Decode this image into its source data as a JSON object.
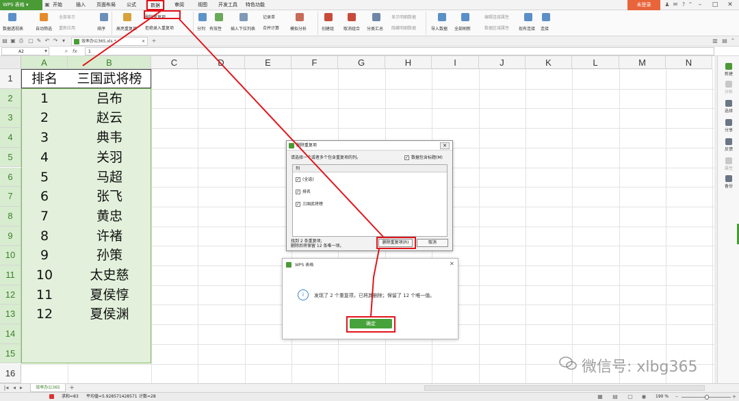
{
  "app": {
    "name": "WPS 表格",
    "login_label": "未登录"
  },
  "menu": {
    "tabs": [
      "开始",
      "插入",
      "页面布局",
      "公式",
      "数据",
      "审阅",
      "视图",
      "开发工具",
      "特色功能"
    ],
    "active_tab": "数据"
  },
  "ribbon": {
    "items": [
      "数据透视表",
      "自动筛选",
      "全部显示",
      "重新应用",
      "排序",
      "高亮重复项",
      "删除重复项",
      "拒绝录入重复项",
      "分列",
      "有效性",
      "插入下拉列表",
      "合并计算",
      "记录单",
      "模拟分析",
      "创建组",
      "取消组合",
      "分类汇总",
      "显示明细数据",
      "隐藏明细数据",
      "导入数据",
      "全部刷新",
      "编辑连接属性",
      "数据区域属性",
      "现有连接",
      "连接"
    ]
  },
  "document": {
    "tab_title": "效率办公365.xls *"
  },
  "formula_bar": {
    "cell_ref": "A2",
    "fx_label": "fx",
    "value": "1"
  },
  "sheet": {
    "columns": [
      "A",
      "B",
      "C",
      "D",
      "E",
      "F",
      "G",
      "H",
      "I",
      "J",
      "K",
      "L",
      "M",
      "N"
    ],
    "row_numbers": [
      "1",
      "2",
      "3",
      "4",
      "5",
      "6",
      "7",
      "8",
      "9",
      "10",
      "11",
      "12",
      "13",
      "14",
      "15",
      "16"
    ],
    "header_row": {
      "rank": "排名",
      "name": "三国武将榜"
    },
    "rows": [
      {
        "rank": "1",
        "name": "吕布"
      },
      {
        "rank": "2",
        "name": "赵云"
      },
      {
        "rank": "3",
        "name": "典韦"
      },
      {
        "rank": "4",
        "name": "关羽"
      },
      {
        "rank": "5",
        "name": "马超"
      },
      {
        "rank": "6",
        "name": "张飞"
      },
      {
        "rank": "7",
        "name": "黄忠"
      },
      {
        "rank": "8",
        "name": "许褚"
      },
      {
        "rank": "9",
        "name": "孙策"
      },
      {
        "rank": "10",
        "name": "太史慈"
      },
      {
        "rank": "11",
        "name": "夏侯惇"
      },
      {
        "rank": "12",
        "name": "夏侯渊"
      }
    ],
    "sheet_tab": "效率办公365",
    "add_sheet": "+"
  },
  "dialog_remove": {
    "title": "删除重复项",
    "prompt": "请选择一个或者多个包含重复项的列。",
    "header_checkbox": "数据包含标题(M)",
    "list_header": "列",
    "list_items": [
      "(全选)",
      "排名",
      "三国武将榜"
    ],
    "found_line1": "找到 2 条重复项;",
    "found_line2": "删除后将保留 12 条唯一项。",
    "remove_button": "删除重复项(R)",
    "cancel_button": "取消"
  },
  "dialog_result": {
    "title": "WPS 表格",
    "message": "发现了 2 个重复项，已将其删除；保留了 12 个唯一值。",
    "ok_button": "确定"
  },
  "right_sidebar": [
    "新建",
    "分析",
    "选择",
    "分享",
    "反馈",
    "属性",
    "备份"
  ],
  "status": {
    "sum": "求和=83",
    "average": "平均值=5.928571428571",
    "count": "计数=28",
    "zoom": "190 %"
  },
  "watermark": "微信号: xlbg365",
  "colors": {
    "wps_green": "#4a9a36",
    "annotation_red": "#e0141a",
    "login_orange": "#e8643a"
  }
}
